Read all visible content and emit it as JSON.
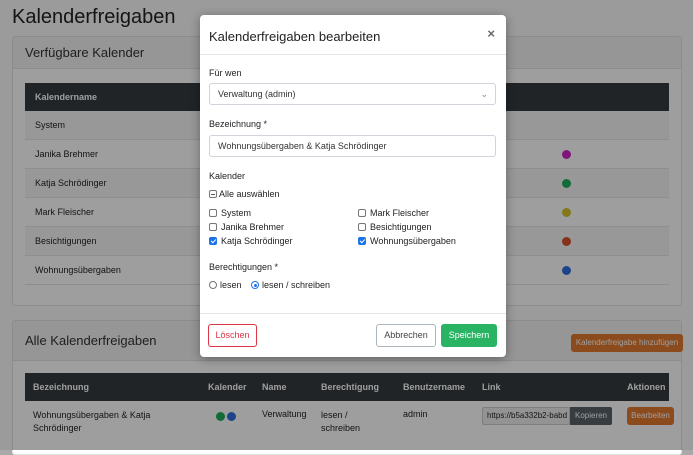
{
  "page": {
    "title": "Kalenderfreigaben",
    "available": {
      "header": "Verfügbare Kalender",
      "column": "Kalendername",
      "rows": [
        {
          "name": "System",
          "color": ""
        },
        {
          "name": "Janika Brehmer",
          "color": "#d020c8"
        },
        {
          "name": "Katja Schrödinger",
          "color": "#1fae5b"
        },
        {
          "name": "Mark Fleischer",
          "color": "#d4c12a"
        },
        {
          "name": "Besichtigungen",
          "color": "#d8522a"
        },
        {
          "name": "Wohnungsübergaben",
          "color": "#2f6fdc"
        }
      ]
    },
    "all_shares": {
      "header": "Alle Kalenderfreigaben",
      "add_button": "Kalenderfreigabe hinzufügen",
      "columns": [
        "Bezeichnung",
        "Kalender",
        "Name",
        "Berechtigung",
        "Benutzername",
        "Link",
        "Aktionen"
      ],
      "row": {
        "bezeichnung_1": "Wohnungsübergaben & Katja",
        "bezeichnung_2": "Schrödinger",
        "dot_colors": [
          "#1fae5b",
          "#2f6fdc"
        ],
        "name": "Verwaltung",
        "berechtigung_1": "lesen /",
        "berechtigung_2": "schreiben",
        "benutzername": "admin",
        "link": "https://b5a332b2-babd",
        "copy_button": "Kopieren",
        "edit_button": "Bearbeiten"
      }
    }
  },
  "modal": {
    "title": "Kalenderfreigaben bearbeiten",
    "close": "×",
    "for_label": "Für wen",
    "for_value": "Verwaltung (admin)",
    "name_label": "Bezeichnung *",
    "name_value": "Wohnungsübergaben & Katja Schrödinger",
    "calendar_label": "Kalender",
    "select_all": "Alle auswählen",
    "calendars_left": [
      {
        "label": "System",
        "checked": false
      },
      {
        "label": "Janika Brehmer",
        "checked": false
      },
      {
        "label": "Katja Schrödinger",
        "checked": true
      }
    ],
    "calendars_right": [
      {
        "label": "Mark Fleischer",
        "checked": false
      },
      {
        "label": "Besichtigungen",
        "checked": false
      },
      {
        "label": "Wohnungsübergaben",
        "checked": true
      }
    ],
    "perm_label": "Berechtigungen *",
    "perm_read": "lesen",
    "perm_readwrite": "lesen / schreiben",
    "perm_selected": "lesen / schreiben",
    "delete_button": "Löschen",
    "cancel_button": "Abbrechen",
    "save_button": "Speichern"
  },
  "colors": {
    "accent_blue": "#1a73e8",
    "save_green": "#28b463",
    "delete_red": "#dc3545",
    "orange": "#e07a2e",
    "table_header": "#343a40"
  }
}
